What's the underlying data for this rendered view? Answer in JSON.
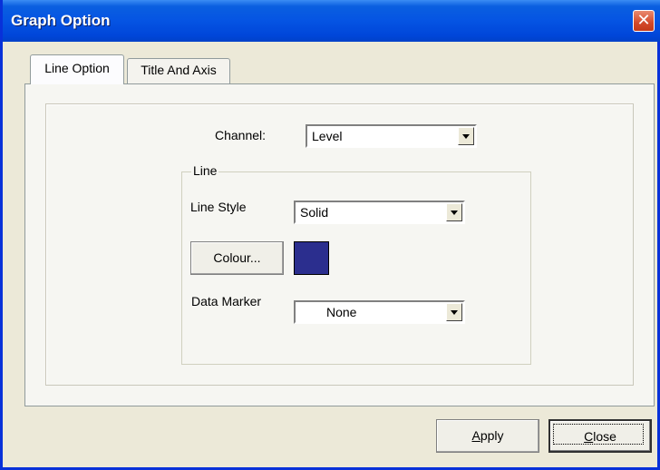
{
  "window": {
    "title": "Graph Option",
    "close_icon": "close-icon"
  },
  "tabs": [
    {
      "label": "Line Option",
      "active": true
    },
    {
      "label": "Title And Axis",
      "active": false
    }
  ],
  "channel": {
    "label": "Channel:",
    "value": "Level"
  },
  "line_group": {
    "legend": "Line",
    "line_style": {
      "label": "Line Style",
      "value": "Solid"
    },
    "colour": {
      "button_label": "Colour...",
      "swatch_color": "#2b2e8e"
    },
    "data_marker": {
      "label": "Data Marker",
      "value": "None"
    }
  },
  "buttons": {
    "apply": {
      "mnemonic": "A",
      "rest": "pply"
    },
    "close": {
      "mnemonic": "C",
      "rest": "lose"
    }
  },
  "colors": {
    "titlebar": "#0554e3",
    "close_button": "#d3492a",
    "dialog_background": "#ece9d8"
  }
}
